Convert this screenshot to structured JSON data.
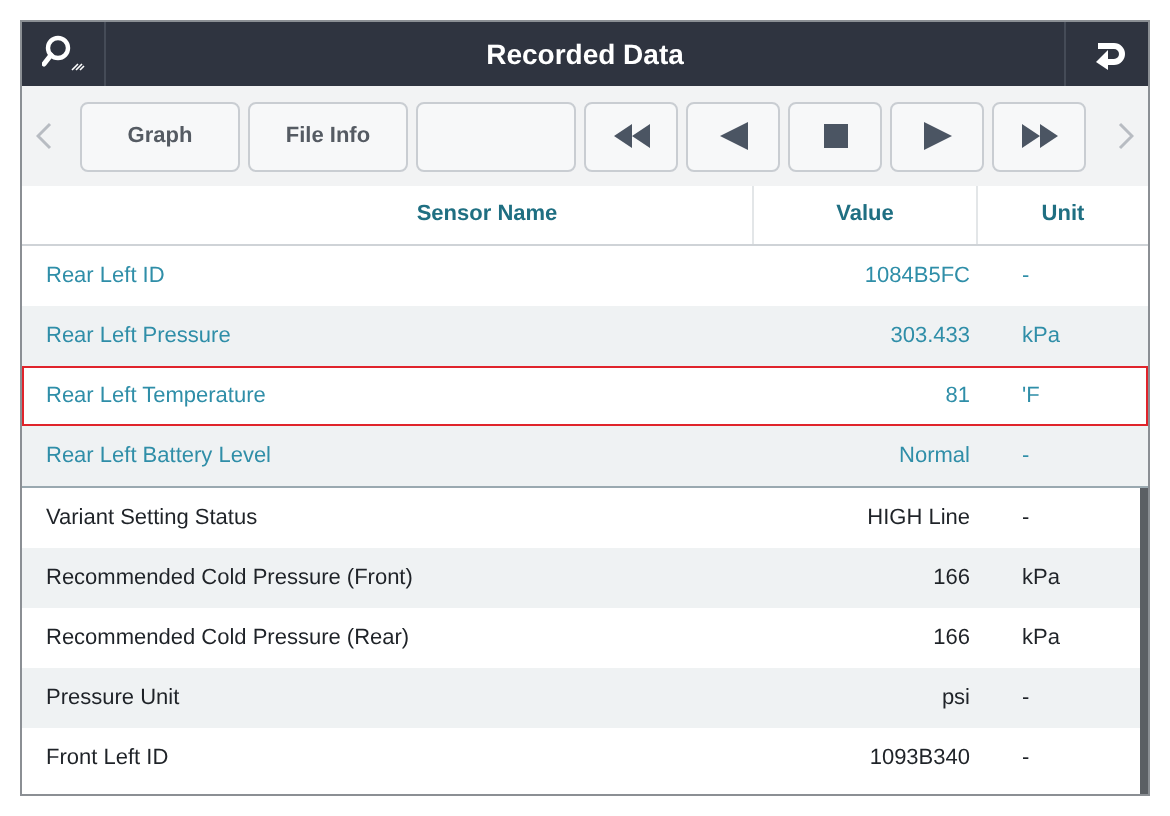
{
  "window": {
    "title": "Recorded Data"
  },
  "toolbar": {
    "buttons": [
      {
        "kind": "text",
        "label": "Graph"
      },
      {
        "kind": "text",
        "label": "File Info"
      },
      {
        "kind": "blank"
      },
      {
        "kind": "rewind"
      },
      {
        "kind": "back"
      },
      {
        "kind": "stop"
      },
      {
        "kind": "play"
      },
      {
        "kind": "forward"
      }
    ]
  },
  "table": {
    "columns": [
      "Sensor Name",
      "Value",
      "Unit"
    ],
    "rows": [
      {
        "kind": "pinned",
        "name": "Rear Left ID",
        "value": "1084B5FC",
        "unit": "-",
        "selected": false
      },
      {
        "kind": "pinned",
        "name": "Rear Left Pressure",
        "value": "303.433",
        "unit": "kPa",
        "selected": false
      },
      {
        "kind": "pinned",
        "name": "Rear Left Temperature",
        "value": "81",
        "unit": "'F",
        "selected": true
      },
      {
        "kind": "pinned",
        "name": "Rear Left Battery Level",
        "value": "Normal",
        "unit": "-",
        "selected": false
      },
      {
        "kind": "normal",
        "name": "Variant Setting Status",
        "value": "HIGH Line",
        "unit": "-",
        "selected": false
      },
      {
        "kind": "normal",
        "name": "Recommended Cold Pressure (Front)",
        "value": "166",
        "unit": "kPa",
        "selected": false
      },
      {
        "kind": "normal",
        "name": "Recommended Cold Pressure (Rear)",
        "value": "166",
        "unit": "kPa",
        "selected": false
      },
      {
        "kind": "normal",
        "name": "Pressure Unit",
        "value": "psi",
        "unit": "-",
        "selected": false
      },
      {
        "kind": "normal",
        "name": "Front Left ID",
        "value": "1093B340",
        "unit": "-",
        "selected": false
      }
    ]
  }
}
